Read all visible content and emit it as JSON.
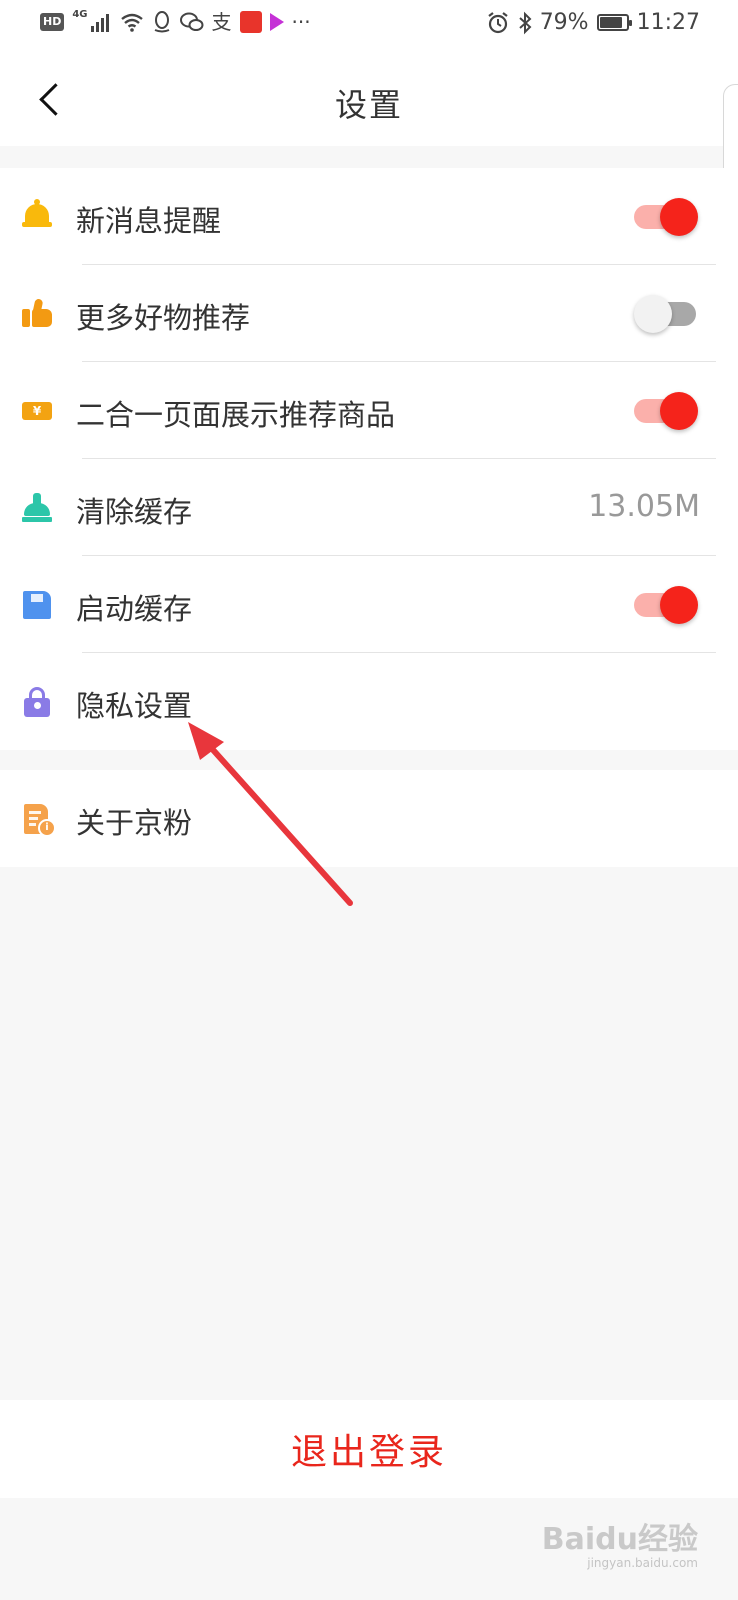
{
  "status_bar": {
    "hd": "HD",
    "network": "4G",
    "alipay_glyph": "支",
    "more": "···",
    "battery_text": "79%",
    "battery_level_pct": 79,
    "time": "11:27"
  },
  "header": {
    "title": "设置"
  },
  "settings_group_1": [
    {
      "label": "新消息提醒",
      "icon": "bell-icon",
      "toggle": true
    },
    {
      "label": "更多好物推荐",
      "icon": "thumbs-up-icon",
      "toggle": false
    },
    {
      "label": "二合一页面展示推荐商品",
      "icon": "ticket-icon",
      "toggle": true
    },
    {
      "label": "清除缓存",
      "icon": "broom-icon",
      "value": "13.05M"
    },
    {
      "label": "启动缓存",
      "icon": "save-disk-icon",
      "toggle": true
    },
    {
      "label": "隐私设置",
      "icon": "lock-icon"
    }
  ],
  "settings_group_2": [
    {
      "label": "关于京粉",
      "icon": "document-info-icon"
    }
  ],
  "logout": {
    "label": "退出登录"
  },
  "watermark": {
    "brand": "Baidu经验",
    "url": "jingyan.baidu.com"
  },
  "colors": {
    "toggle_on": "#f5231b",
    "toggle_on_track": "#fbb0ab",
    "toggle_off_track": "#a8a8a8",
    "logout_text": "#e9261c",
    "annotation_arrow": "#e8363c"
  }
}
